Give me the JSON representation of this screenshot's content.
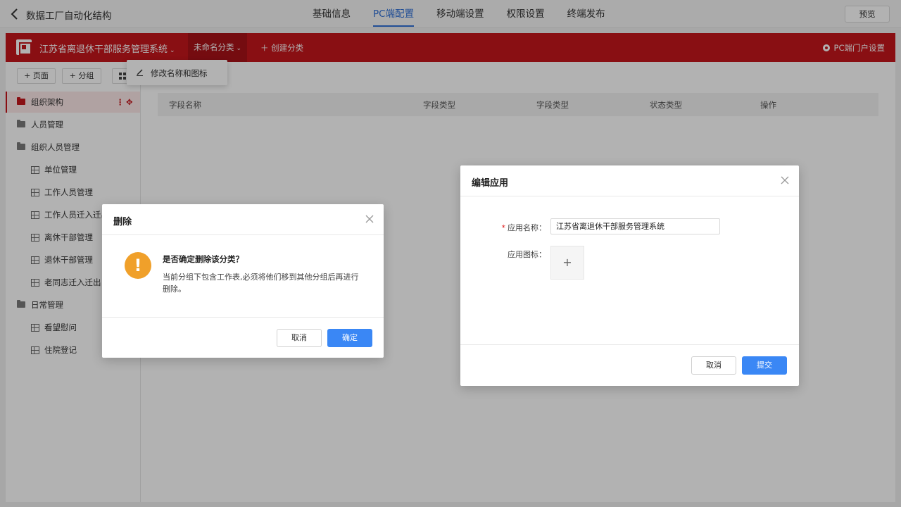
{
  "topbar": {
    "title": "数据工厂自动化结构",
    "tabs": [
      {
        "label": "基础信息",
        "active": false
      },
      {
        "label": "PC端配置",
        "active": true
      },
      {
        "label": "移动端设置",
        "active": false
      },
      {
        "label": "权限设置",
        "active": false
      },
      {
        "label": "终端发布",
        "active": false
      }
    ],
    "preview_label": "预览"
  },
  "appbar": {
    "app_name": "江苏省离退休干部服务管理系统",
    "category_label": "未命名分类",
    "create_category_label": "创建分类",
    "portal_settings_label": "PC端门户设置",
    "brand_color": "#c4161c"
  },
  "toolbar": {
    "add_page_label": "+ 页面",
    "add_group_label": "+ 分组"
  },
  "dropdown": {
    "rename_label": "修改名称和图标"
  },
  "sidebar": {
    "items": [
      {
        "label": "组织架构",
        "type": "folder",
        "level": 0,
        "active": true
      },
      {
        "label": "人员管理",
        "type": "folder",
        "level": 0,
        "active": false
      },
      {
        "label": "组织人员管理",
        "type": "folder",
        "level": 0,
        "active": false
      },
      {
        "label": "单位管理",
        "type": "table",
        "level": 1,
        "active": false
      },
      {
        "label": "工作人员管理",
        "type": "table",
        "level": 1,
        "active": false
      },
      {
        "label": "工作人员迁入迁出",
        "type": "table",
        "level": 1,
        "active": false
      },
      {
        "label": "离休干部管理",
        "type": "table",
        "level": 1,
        "active": false
      },
      {
        "label": "退休干部管理",
        "type": "table",
        "level": 1,
        "active": false
      },
      {
        "label": "老同志迁入迁出",
        "type": "table",
        "level": 1,
        "active": false
      },
      {
        "label": "日常管理",
        "type": "folder",
        "level": 0,
        "active": false
      },
      {
        "label": "看望慰问",
        "type": "table",
        "level": 1,
        "active": false
      },
      {
        "label": "住院登记",
        "type": "table",
        "level": 1,
        "active": false
      }
    ]
  },
  "table": {
    "columns": [
      "字段名称",
      "字段类型",
      "字段类型",
      "状态类型",
      "操作"
    ]
  },
  "delete_dialog": {
    "title": "删除",
    "question": "是否确定删除该分类？",
    "description": "当前分组下包含工作表,必须将他们移到其他分组后再进行删除。",
    "cancel_label": "取消",
    "confirm_label": "确定"
  },
  "edit_dialog": {
    "title": "编辑应用",
    "name_label": "应用名称：",
    "name_value": "江苏省离退休干部服务管理系统",
    "icon_label": "应用图标：",
    "cancel_label": "取消",
    "submit_label": "提交"
  }
}
